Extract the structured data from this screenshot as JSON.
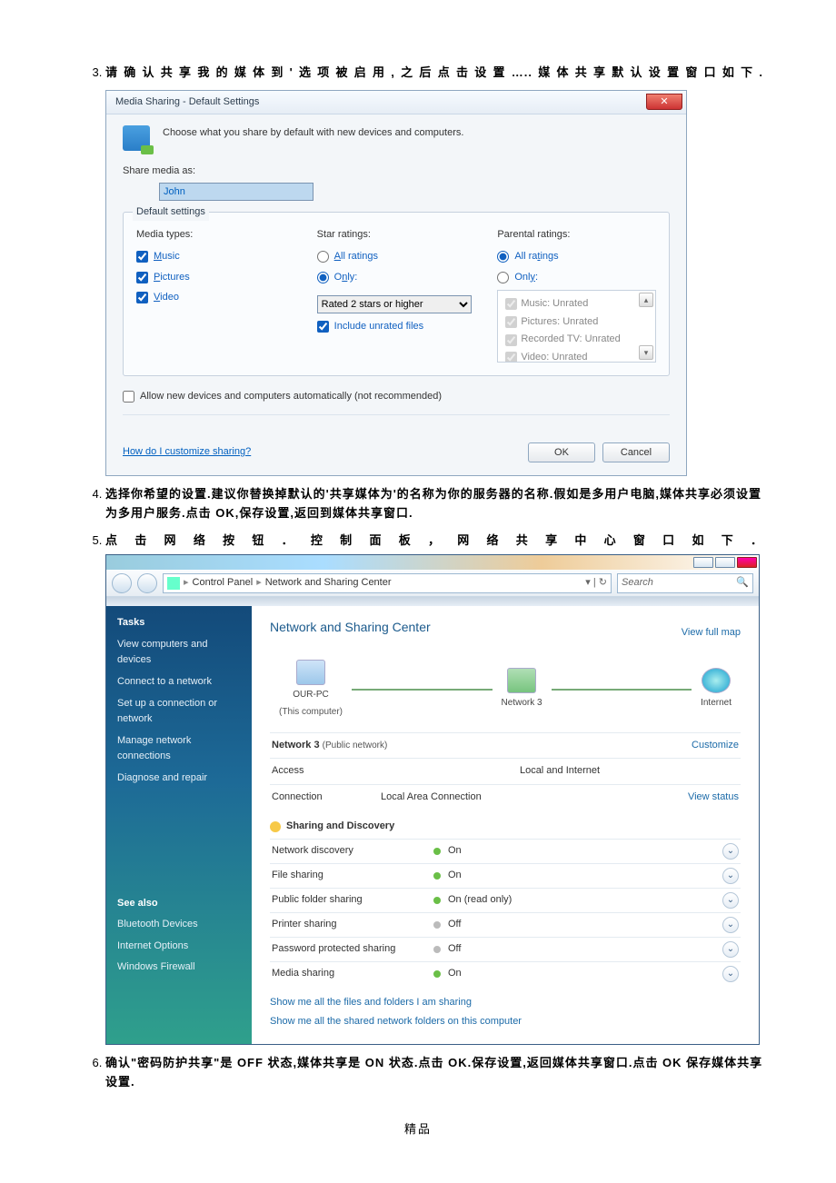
{
  "doc": {
    "step3": "请确认共享我的媒体到'选项被启用,之后点击设置…..媒体共享默认设置窗口如下.",
    "step4": "选择你希望的设置.建议你替换掉默认的'共享媒体为'的名称为你的服务器的名称.假如是多用户电脑,媒体共享必须设置为多用户服务.点击 OK,保存设置,返回到媒体共享窗口.",
    "step5": "点击网络按钮．控制面板，网络共享中心窗口如下．",
    "step6": "确认\"密码防护共享\"是 OFF 状态,媒体共享是 ON 状态.点击 OK.保存设置,返回媒体共享窗口.点击 OK 保存媒体共享设置.",
    "footer": "精品"
  },
  "dlg1": {
    "title": "Media Sharing - Default Settings",
    "intro": "Choose what you share by default with new devices and computers.",
    "share_label": "Share media as:",
    "share_value": "John",
    "group_title": "Default settings",
    "col_media": "Media types:",
    "m1": "Music",
    "m2": "Pictures",
    "m3": "Video",
    "col_star": "Star ratings:",
    "star_all": "All ratings",
    "star_only": "Only:",
    "star_dd": "Rated 2 stars or higher",
    "star_inc": "Include unrated files",
    "col_par": "Parental ratings:",
    "par_all": "All ratings",
    "par_only": "Only:",
    "p1": "Music: Unrated",
    "p2": "Pictures: Unrated",
    "p3": "Recorded TV: Unrated",
    "p4": "Video: Unrated",
    "allow": "Allow new devices and computers automatically (not recommended)",
    "help": "How do I customize sharing?",
    "ok": "OK",
    "cancel": "Cancel"
  },
  "dlg2": {
    "crumb1": "Control Panel",
    "crumb2": "Network and Sharing Center",
    "search": "Search",
    "tasks": "Tasks",
    "t1": "View computers and devices",
    "t2": "Connect to a network",
    "t3": "Set up a connection or network",
    "t4": "Manage network connections",
    "t5": "Diagnose and repair",
    "see": "See also",
    "s1": "Bluetooth Devices",
    "s2": "Internet Options",
    "s3": "Windows Firewall",
    "title": "Network and Sharing Center",
    "fullmap": "View full map",
    "n1": "OUR-PC",
    "n1b": "(This computer)",
    "n2": "Network  3",
    "n3": "Internet",
    "net3": "Network 3",
    "net3p": "(Public network)",
    "cust": "Customize",
    "access": "Access",
    "access_v": "Local and Internet",
    "conn": "Connection",
    "conn_v": "Local Area Connection",
    "viewst": "View status",
    "shhead": "Sharing and Discovery",
    "r1": "Network discovery",
    "r1v": "On",
    "r2": "File sharing",
    "r2v": "On",
    "r3": "Public folder sharing",
    "r3v": "On (read only)",
    "r4": "Printer sharing",
    "r4v": "Off",
    "r5": "Password protected sharing",
    "r5v": "Off",
    "r6": "Media sharing",
    "r6v": "On",
    "l1": "Show me all the files and folders I am sharing",
    "l2": "Show me all the shared network folders on this computer"
  }
}
